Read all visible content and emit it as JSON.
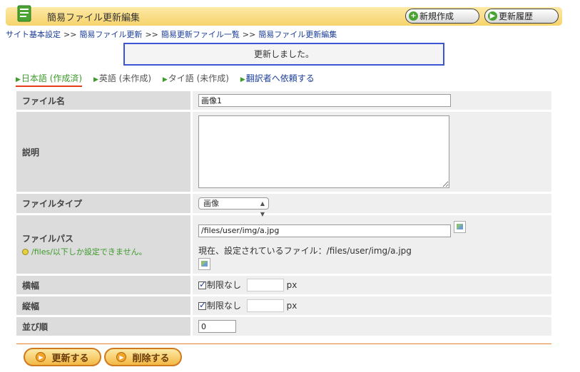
{
  "header": {
    "title": "簡易ファイル更新編集",
    "new_label": "新規作成",
    "history_label": "更新履歴"
  },
  "breadcrumb": [
    "サイト基本設定",
    "簡易ファイル更新",
    "簡易更新ファイル一覧",
    "簡易ファイル更新編集"
  ],
  "breadcrumb_separator": ">>",
  "message": "更新しました。",
  "lang_tabs": [
    {
      "label": "日本語 (作成済)",
      "active": true
    },
    {
      "label": "英語 (未作成)"
    },
    {
      "label": "タイ語 (未作成)"
    },
    {
      "label": "翻訳者へ依頼する",
      "link": true
    }
  ],
  "form": {
    "file_name": {
      "label": "ファイル名",
      "value": "画像1"
    },
    "description": {
      "label": "説明",
      "value": ""
    },
    "file_type": {
      "label": "ファイルタイプ",
      "selected": "画像"
    },
    "file_path": {
      "label": "ファイルパス",
      "note": "/files/以下しか設定できません。",
      "value": "/files/user/img/a.jpg",
      "current_label": "現在、設定されているファイル：",
      "current_value": "/files/user/img/a.jpg"
    },
    "width": {
      "label": "横幅",
      "checkbox_label": "制限なし",
      "value": "",
      "unit": "px"
    },
    "height": {
      "label": "縦幅",
      "checkbox_label": "制限なし",
      "value": "",
      "unit": "px"
    },
    "order": {
      "label": "並び順",
      "value": "0"
    }
  },
  "actions": {
    "update_label": "更新する",
    "delete_label": "削除する"
  },
  "colors": {
    "title_bar": "#f6d36b",
    "accent_green": "#3d9a2b",
    "link_blue": "#1a3d9a",
    "message_border": "#3b55d6",
    "action_orange": "#f3b843"
  }
}
